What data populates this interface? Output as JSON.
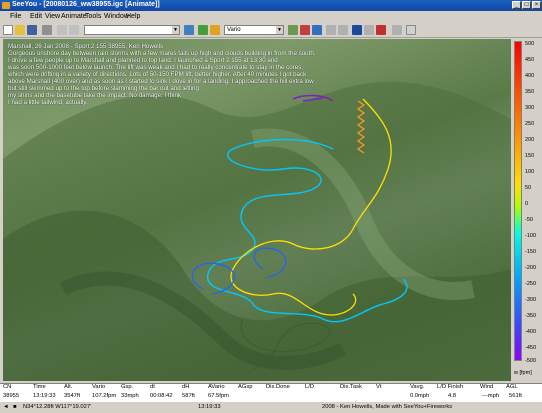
{
  "window": {
    "title": "SeeYou - [20080126_ww38955.igc [Animate]]"
  },
  "menu": [
    "File",
    "Edit",
    "View",
    "Animate",
    "Tools",
    "Window",
    "Help"
  ],
  "toolbar": {
    "vario_combo": "Vario"
  },
  "flight_description": "Marshall, 26 Jan 2008 - Sport 2 155 38955, Ken Howells\nGorgeous onshore day between rain storms with a few mares tails up high and clouds building in from the south.\nI drove a few people up to Marshall and planned to top land. I launched a Sport 2 155 at 13:30 and\nwas soon 500-1000 feet below launch.  The lift was weak and I had to really concentrate to stay in the cores,\nwhich were drifting in a variety of directions.  Lots of 50-150 FPM lift, better higher.  After 40 minutes I got back\nabove Marshall (400 over) and as soon as I started to sink I dove in for a landing.  I approached the hill extra low\nbut still skimmed up to the top before slamming the bar out and letting\nmy shins and the basetube take the impact.  No damage.  I think\nI had a little tailwind, actually.",
  "scale": {
    "ticks": [
      "500",
      "450",
      "400",
      "350",
      "300",
      "250",
      "200",
      "150",
      "100",
      "50",
      "0",
      "-50",
      "-100",
      "-150",
      "-200",
      "-250",
      "-300",
      "-350",
      "-400",
      "-450",
      "-500"
    ],
    "unit": "w [fpm]"
  },
  "status_headers": [
    "CN",
    "Time",
    "Alt.",
    "Vario",
    "Gsp.",
    "dt",
    "dH",
    "AVario",
    "AGsp",
    "Dis.Done",
    "L/D",
    "Dis.Task",
    "Vt",
    "Vavg.",
    "L/D Finish",
    "Wind",
    "AGL"
  ],
  "status_values": [
    "38955",
    "13:19:33",
    "3547ft",
    "107.2fpm",
    "33mph",
    "00:08:42",
    "587ft",
    "67.5fpm",
    "",
    "",
    "",
    "",
    "",
    "0.0mph",
    "4.8",
    "",
    "---mph",
    "561ft"
  ],
  "bottom": {
    "coords": "N34°12.28ft  W117°19.027'",
    "time": "13:19:33",
    "credit": "2008 - Ken Howells, Made with SeeYou+Fireworks"
  },
  "colors": {
    "track_cyan": "#00c8ff",
    "track_yellow": "#ffe000",
    "track_orange": "#ff9a20",
    "track_blue": "#2060ff"
  }
}
